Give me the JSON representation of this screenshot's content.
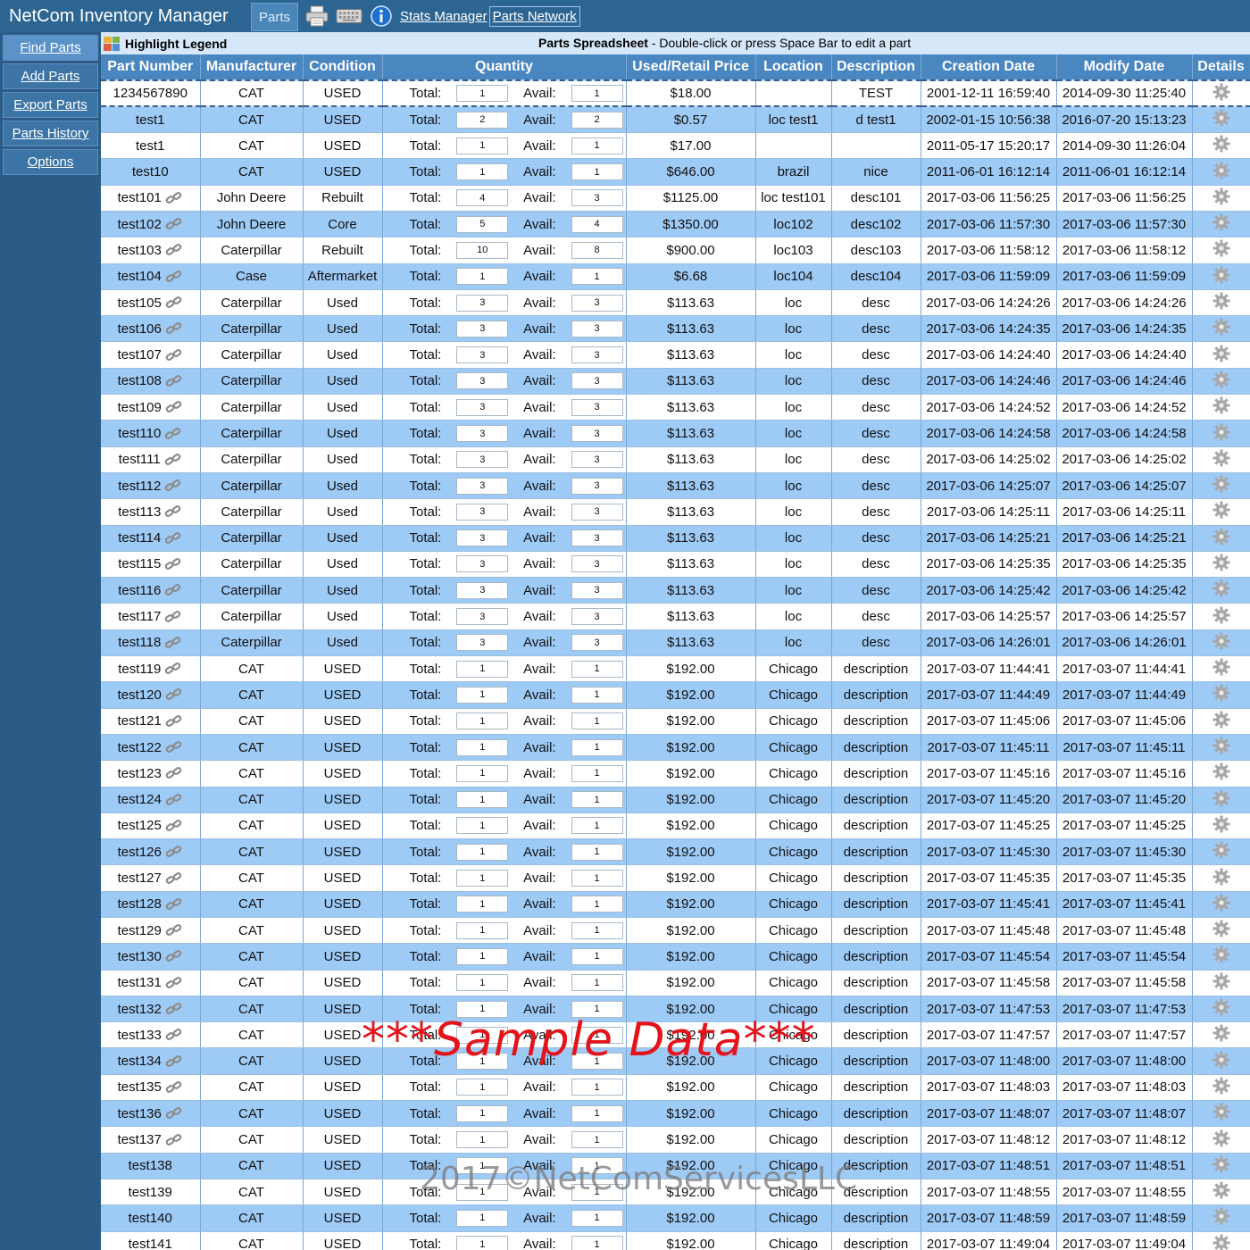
{
  "app": {
    "title": "NetCom Inventory Manager",
    "tab_parts": "Parts",
    "link_stats": "Stats Manager",
    "link_network": "Parts Network"
  },
  "sidebar": {
    "items": [
      {
        "label": "Find Parts"
      },
      {
        "label": "Add Parts"
      },
      {
        "label": "Export Parts"
      },
      {
        "label": "Parts History"
      },
      {
        "label": "Options"
      }
    ]
  },
  "legendbar": {
    "legend_label": "Highlight Legend",
    "sheet_title": "Parts Spreadsheet",
    "sheet_hint": " - Double-click or press Space Bar to edit a part"
  },
  "table": {
    "headers": [
      "Part Number",
      "Manufacturer",
      "Condition",
      "Quantity",
      "Used/Retail Price",
      "Location",
      "Description",
      "Creation Date",
      "Modify Date",
      "Details"
    ],
    "total_label": "Total:",
    "avail_label": "Avail:",
    "rows": [
      {
        "pn": "1234567890",
        "mfr": "CAT",
        "cond": "USED",
        "total": "1",
        "avail": "1",
        "price": "$18.00",
        "loc": "",
        "desc": "TEST",
        "created": "2001-12-11 16:59:40",
        "modified": "2014-09-30 11:25:40",
        "linked": false
      },
      {
        "pn": "test1",
        "mfr": "CAT",
        "cond": "USED",
        "total": "2",
        "avail": "2",
        "price": "$0.57",
        "loc": "loc test1",
        "desc": "d test1",
        "created": "2002-01-15 10:56:38",
        "modified": "2016-07-20 15:13:23",
        "linked": false
      },
      {
        "pn": "test1",
        "mfr": "CAT",
        "cond": "USED",
        "total": "1",
        "avail": "1",
        "price": "$17.00",
        "loc": "",
        "desc": "",
        "created": "2011-05-17 15:20:17",
        "modified": "2014-09-30 11:26:04",
        "linked": false
      },
      {
        "pn": "test10",
        "mfr": "CAT",
        "cond": "USED",
        "total": "1",
        "avail": "1",
        "price": "$646.00",
        "loc": "brazil",
        "desc": "nice",
        "created": "2011-06-01 16:12:14",
        "modified": "2011-06-01 16:12:14",
        "linked": false
      },
      {
        "pn": "test101",
        "mfr": "John Deere",
        "cond": "Rebuilt",
        "total": "4",
        "avail": "3",
        "price": "$1125.00",
        "loc": "loc test101",
        "desc": "desc101",
        "created": "2017-03-06 11:56:25",
        "modified": "2017-03-06 11:56:25",
        "linked": true
      },
      {
        "pn": "test102",
        "mfr": "John Deere",
        "cond": "Core",
        "total": "5",
        "avail": "4",
        "price": "$1350.00",
        "loc": "loc102",
        "desc": "desc102",
        "created": "2017-03-06 11:57:30",
        "modified": "2017-03-06 11:57:30",
        "linked": true
      },
      {
        "pn": "test103",
        "mfr": "Caterpillar",
        "cond": "Rebuilt",
        "total": "10",
        "avail": "8",
        "price": "$900.00",
        "loc": "loc103",
        "desc": "desc103",
        "created": "2017-03-06 11:58:12",
        "modified": "2017-03-06 11:58:12",
        "linked": true
      },
      {
        "pn": "test104",
        "mfr": "Case",
        "cond": "Aftermarket",
        "total": "1",
        "avail": "1",
        "price": "$6.68",
        "loc": "loc104",
        "desc": "desc104",
        "created": "2017-03-06 11:59:09",
        "modified": "2017-03-06 11:59:09",
        "linked": true
      },
      {
        "pn": "test105",
        "mfr": "Caterpillar",
        "cond": "Used",
        "total": "3",
        "avail": "3",
        "price": "$113.63",
        "loc": "loc",
        "desc": "desc",
        "created": "2017-03-06 14:24:26",
        "modified": "2017-03-06 14:24:26",
        "linked": true
      },
      {
        "pn": "test106",
        "mfr": "Caterpillar",
        "cond": "Used",
        "total": "3",
        "avail": "3",
        "price": "$113.63",
        "loc": "loc",
        "desc": "desc",
        "created": "2017-03-06 14:24:35",
        "modified": "2017-03-06 14:24:35",
        "linked": true
      },
      {
        "pn": "test107",
        "mfr": "Caterpillar",
        "cond": "Used",
        "total": "3",
        "avail": "3",
        "price": "$113.63",
        "loc": "loc",
        "desc": "desc",
        "created": "2017-03-06 14:24:40",
        "modified": "2017-03-06 14:24:40",
        "linked": true
      },
      {
        "pn": "test108",
        "mfr": "Caterpillar",
        "cond": "Used",
        "total": "3",
        "avail": "3",
        "price": "$113.63",
        "loc": "loc",
        "desc": "desc",
        "created": "2017-03-06 14:24:46",
        "modified": "2017-03-06 14:24:46",
        "linked": true
      },
      {
        "pn": "test109",
        "mfr": "Caterpillar",
        "cond": "Used",
        "total": "3",
        "avail": "3",
        "price": "$113.63",
        "loc": "loc",
        "desc": "desc",
        "created": "2017-03-06 14:24:52",
        "modified": "2017-03-06 14:24:52",
        "linked": true
      },
      {
        "pn": "test110",
        "mfr": "Caterpillar",
        "cond": "Used",
        "total": "3",
        "avail": "3",
        "price": "$113.63",
        "loc": "loc",
        "desc": "desc",
        "created": "2017-03-06 14:24:58",
        "modified": "2017-03-06 14:24:58",
        "linked": true
      },
      {
        "pn": "test111",
        "mfr": "Caterpillar",
        "cond": "Used",
        "total": "3",
        "avail": "3",
        "price": "$113.63",
        "loc": "loc",
        "desc": "desc",
        "created": "2017-03-06 14:25:02",
        "modified": "2017-03-06 14:25:02",
        "linked": true
      },
      {
        "pn": "test112",
        "mfr": "Caterpillar",
        "cond": "Used",
        "total": "3",
        "avail": "3",
        "price": "$113.63",
        "loc": "loc",
        "desc": "desc",
        "created": "2017-03-06 14:25:07",
        "modified": "2017-03-06 14:25:07",
        "linked": true
      },
      {
        "pn": "test113",
        "mfr": "Caterpillar",
        "cond": "Used",
        "total": "3",
        "avail": "3",
        "price": "$113.63",
        "loc": "loc",
        "desc": "desc",
        "created": "2017-03-06 14:25:11",
        "modified": "2017-03-06 14:25:11",
        "linked": true
      },
      {
        "pn": "test114",
        "mfr": "Caterpillar",
        "cond": "Used",
        "total": "3",
        "avail": "3",
        "price": "$113.63",
        "loc": "loc",
        "desc": "desc",
        "created": "2017-03-06 14:25:21",
        "modified": "2017-03-06 14:25:21",
        "linked": true
      },
      {
        "pn": "test115",
        "mfr": "Caterpillar",
        "cond": "Used",
        "total": "3",
        "avail": "3",
        "price": "$113.63",
        "loc": "loc",
        "desc": "desc",
        "created": "2017-03-06 14:25:35",
        "modified": "2017-03-06 14:25:35",
        "linked": true
      },
      {
        "pn": "test116",
        "mfr": "Caterpillar",
        "cond": "Used",
        "total": "3",
        "avail": "3",
        "price": "$113.63",
        "loc": "loc",
        "desc": "desc",
        "created": "2017-03-06 14:25:42",
        "modified": "2017-03-06 14:25:42",
        "linked": true
      },
      {
        "pn": "test117",
        "mfr": "Caterpillar",
        "cond": "Used",
        "total": "3",
        "avail": "3",
        "price": "$113.63",
        "loc": "loc",
        "desc": "desc",
        "created": "2017-03-06 14:25:57",
        "modified": "2017-03-06 14:25:57",
        "linked": true
      },
      {
        "pn": "test118",
        "mfr": "Caterpillar",
        "cond": "Used",
        "total": "3",
        "avail": "3",
        "price": "$113.63",
        "loc": "loc",
        "desc": "desc",
        "created": "2017-03-06 14:26:01",
        "modified": "2017-03-06 14:26:01",
        "linked": true
      },
      {
        "pn": "test119",
        "mfr": "CAT",
        "cond": "USED",
        "total": "1",
        "avail": "1",
        "price": "$192.00",
        "loc": "Chicago",
        "desc": "description",
        "created": "2017-03-07 11:44:41",
        "modified": "2017-03-07 11:44:41",
        "linked": true
      },
      {
        "pn": "test120",
        "mfr": "CAT",
        "cond": "USED",
        "total": "1",
        "avail": "1",
        "price": "$192.00",
        "loc": "Chicago",
        "desc": "description",
        "created": "2017-03-07 11:44:49",
        "modified": "2017-03-07 11:44:49",
        "linked": true
      },
      {
        "pn": "test121",
        "mfr": "CAT",
        "cond": "USED",
        "total": "1",
        "avail": "1",
        "price": "$192.00",
        "loc": "Chicago",
        "desc": "description",
        "created": "2017-03-07 11:45:06",
        "modified": "2017-03-07 11:45:06",
        "linked": true
      },
      {
        "pn": "test122",
        "mfr": "CAT",
        "cond": "USED",
        "total": "1",
        "avail": "1",
        "price": "$192.00",
        "loc": "Chicago",
        "desc": "description",
        "created": "2017-03-07 11:45:11",
        "modified": "2017-03-07 11:45:11",
        "linked": true
      },
      {
        "pn": "test123",
        "mfr": "CAT",
        "cond": "USED",
        "total": "1",
        "avail": "1",
        "price": "$192.00",
        "loc": "Chicago",
        "desc": "description",
        "created": "2017-03-07 11:45:16",
        "modified": "2017-03-07 11:45:16",
        "linked": true
      },
      {
        "pn": "test124",
        "mfr": "CAT",
        "cond": "USED",
        "total": "1",
        "avail": "1",
        "price": "$192.00",
        "loc": "Chicago",
        "desc": "description",
        "created": "2017-03-07 11:45:20",
        "modified": "2017-03-07 11:45:20",
        "linked": true
      },
      {
        "pn": "test125",
        "mfr": "CAT",
        "cond": "USED",
        "total": "1",
        "avail": "1",
        "price": "$192.00",
        "loc": "Chicago",
        "desc": "description",
        "created": "2017-03-07 11:45:25",
        "modified": "2017-03-07 11:45:25",
        "linked": true
      },
      {
        "pn": "test126",
        "mfr": "CAT",
        "cond": "USED",
        "total": "1",
        "avail": "1",
        "price": "$192.00",
        "loc": "Chicago",
        "desc": "description",
        "created": "2017-03-07 11:45:30",
        "modified": "2017-03-07 11:45:30",
        "linked": true
      },
      {
        "pn": "test127",
        "mfr": "CAT",
        "cond": "USED",
        "total": "1",
        "avail": "1",
        "price": "$192.00",
        "loc": "Chicago",
        "desc": "description",
        "created": "2017-03-07 11:45:35",
        "modified": "2017-03-07 11:45:35",
        "linked": true
      },
      {
        "pn": "test128",
        "mfr": "CAT",
        "cond": "USED",
        "total": "1",
        "avail": "1",
        "price": "$192.00",
        "loc": "Chicago",
        "desc": "description",
        "created": "2017-03-07 11:45:41",
        "modified": "2017-03-07 11:45:41",
        "linked": true
      },
      {
        "pn": "test129",
        "mfr": "CAT",
        "cond": "USED",
        "total": "1",
        "avail": "1",
        "price": "$192.00",
        "loc": "Chicago",
        "desc": "description",
        "created": "2017-03-07 11:45:48",
        "modified": "2017-03-07 11:45:48",
        "linked": true
      },
      {
        "pn": "test130",
        "mfr": "CAT",
        "cond": "USED",
        "total": "1",
        "avail": "1",
        "price": "$192.00",
        "loc": "Chicago",
        "desc": "description",
        "created": "2017-03-07 11:45:54",
        "modified": "2017-03-07 11:45:54",
        "linked": true
      },
      {
        "pn": "test131",
        "mfr": "CAT",
        "cond": "USED",
        "total": "1",
        "avail": "1",
        "price": "$192.00",
        "loc": "Chicago",
        "desc": "description",
        "created": "2017-03-07 11:45:58",
        "modified": "2017-03-07 11:45:58",
        "linked": true
      },
      {
        "pn": "test132",
        "mfr": "CAT",
        "cond": "USED",
        "total": "1",
        "avail": "1",
        "price": "$192.00",
        "loc": "Chicago",
        "desc": "description",
        "created": "2017-03-07 11:47:53",
        "modified": "2017-03-07 11:47:53",
        "linked": true
      },
      {
        "pn": "test133",
        "mfr": "CAT",
        "cond": "USED",
        "total": "1",
        "avail": "1",
        "price": "$192.00",
        "loc": "Chicago",
        "desc": "description",
        "created": "2017-03-07 11:47:57",
        "modified": "2017-03-07 11:47:57",
        "linked": true
      },
      {
        "pn": "test134",
        "mfr": "CAT",
        "cond": "USED",
        "total": "1",
        "avail": "1",
        "price": "$192.00",
        "loc": "Chicago",
        "desc": "description",
        "created": "2017-03-07 11:48:00",
        "modified": "2017-03-07 11:48:00",
        "linked": true
      },
      {
        "pn": "test135",
        "mfr": "CAT",
        "cond": "USED",
        "total": "1",
        "avail": "1",
        "price": "$192.00",
        "loc": "Chicago",
        "desc": "description",
        "created": "2017-03-07 11:48:03",
        "modified": "2017-03-07 11:48:03",
        "linked": true
      },
      {
        "pn": "test136",
        "mfr": "CAT",
        "cond": "USED",
        "total": "1",
        "avail": "1",
        "price": "$192.00",
        "loc": "Chicago",
        "desc": "description",
        "created": "2017-03-07 11:48:07",
        "modified": "2017-03-07 11:48:07",
        "linked": true
      },
      {
        "pn": "test137",
        "mfr": "CAT",
        "cond": "USED",
        "total": "1",
        "avail": "1",
        "price": "$192.00",
        "loc": "Chicago",
        "desc": "description",
        "created": "2017-03-07 11:48:12",
        "modified": "2017-03-07 11:48:12",
        "linked": true
      },
      {
        "pn": "test138",
        "mfr": "CAT",
        "cond": "USED",
        "total": "1",
        "avail": "1",
        "price": "$192.00",
        "loc": "Chicago",
        "desc": "description",
        "created": "2017-03-07 11:48:51",
        "modified": "2017-03-07 11:48:51",
        "linked": false
      },
      {
        "pn": "test139",
        "mfr": "CAT",
        "cond": "USED",
        "total": "1",
        "avail": "1",
        "price": "$192.00",
        "loc": "Chicago",
        "desc": "description",
        "created": "2017-03-07 11:48:55",
        "modified": "2017-03-07 11:48:55",
        "linked": false
      },
      {
        "pn": "test140",
        "mfr": "CAT",
        "cond": "USED",
        "total": "1",
        "avail": "1",
        "price": "$192.00",
        "loc": "Chicago",
        "desc": "description",
        "created": "2017-03-07 11:48:59",
        "modified": "2017-03-07 11:48:59",
        "linked": false
      },
      {
        "pn": "test141",
        "mfr": "CAT",
        "cond": "USED",
        "total": "1",
        "avail": "1",
        "price": "$192.00",
        "loc": "Chicago",
        "desc": "description",
        "created": "2017-03-07 11:49:04",
        "modified": "2017-03-07 11:49:04",
        "linked": false
      }
    ]
  },
  "watermarks": {
    "sample": "***Sample Data***",
    "copyright": "2017©NetComServicesLLC"
  },
  "colors": {
    "header_bg": "#4a86c0",
    "row_odd": "#9ecaf6",
    "row_even": "#ffffff",
    "sidebar_bg": "#2a5c87",
    "watermark_red": "#e3141b"
  },
  "icons": {
    "print": "printer-icon",
    "keyboard": "keyboard-icon",
    "info": "info-icon",
    "legend": "highlight-legend-icon",
    "linked": "link-icon",
    "details": "gear-icon"
  }
}
